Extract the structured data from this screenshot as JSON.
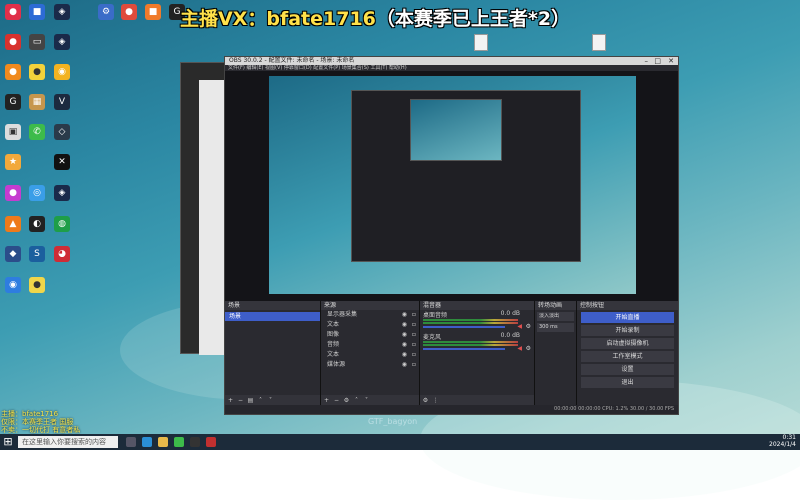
{
  "overlay": {
    "title_main": "主播VX：bfate1716",
    "title_tag": "（本赛季已上王者*2）"
  },
  "obs": {
    "window_title": "OBS 30.0.2 - 配置文件: 未命名 - 场景: 未命名",
    "menu": "文件(F)  编辑(E)  视图(V)  停靠窗口(D)  配置文件(P)  场景集合(S)  工具(T)  帮助(H)",
    "tabs": [
      "场景",
      "源"
    ],
    "scenes_dock": {
      "title": "场景",
      "items": [
        "场景"
      ]
    },
    "sources_dock": {
      "title": "来源",
      "items": [
        "显示器采集",
        "文本",
        "图像",
        "音频",
        "文本",
        "媒体源"
      ]
    },
    "mixer_dock": {
      "title": "混音器",
      "tracks": [
        {
          "name": "桌面音频",
          "db": "0.0 dB"
        },
        {
          "name": "麦克风",
          "db": "0.0 dB"
        }
      ]
    },
    "transitions_dock": {
      "title": "转场动画",
      "type": "淡入淡出",
      "duration": "300 ms"
    },
    "controls_dock": {
      "title": "控制按钮",
      "buttons": [
        "开始直播",
        "开始录制",
        "启动虚拟摄像机",
        "工作室模式",
        "设置",
        "退出"
      ]
    },
    "status": "00:00:00  00:00:00  CPU: 1.2%  30.00 / 30.00 FPS"
  },
  "taskbar": {
    "search_placeholder": "在这里输入你要搜索的内容",
    "time": "0:31",
    "date": "2024/1/4"
  },
  "desktop_files": [
    "",
    ""
  ],
  "streamer_lines": [
    "主播：bfate1716",
    "仅限：本赛季王者 国服",
    "不卖：一切代打 有意者私"
  ],
  "watermark": "GTF_bagyon",
  "colors": {
    "overlay_title": "#ffe14a",
    "accent": "#3e5ec9",
    "obs_bg": "#1f1f24"
  }
}
